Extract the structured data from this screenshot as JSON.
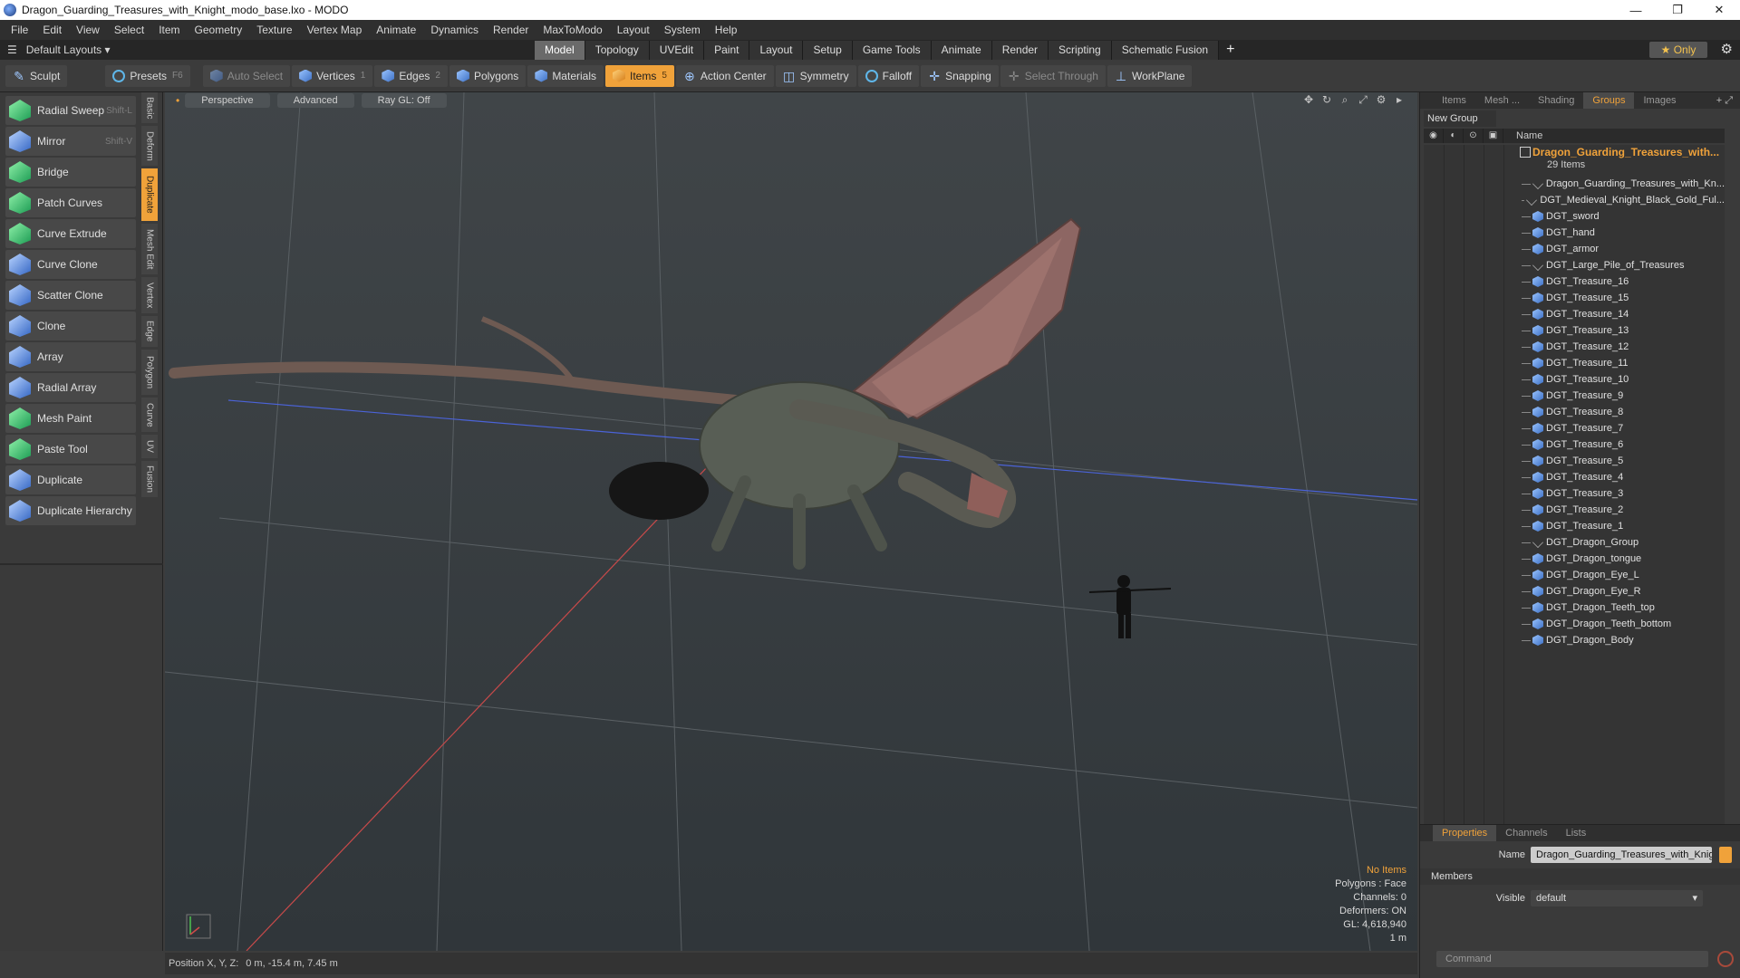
{
  "window": {
    "title": "Dragon_Guarding_Treasures_with_Knight_modo_base.lxo - MODO",
    "controls": [
      "—",
      "❐",
      "✕"
    ]
  },
  "menu": [
    "File",
    "Edit",
    "View",
    "Select",
    "Item",
    "Geometry",
    "Texture",
    "Vertex Map",
    "Animate",
    "Dynamics",
    "Render",
    "MaxToModo",
    "Layout",
    "System",
    "Help"
  ],
  "layouts": {
    "label": "Default Layouts ▾",
    "tabs": [
      "Model",
      "Topology",
      "UVEdit",
      "Paint",
      "Layout",
      "Setup",
      "Game Tools",
      "Animate",
      "Render",
      "Scripting",
      "Schematic Fusion"
    ],
    "active_tab": "Model",
    "only_label": "★  Only"
  },
  "toolbar": {
    "sculpt": "Sculpt",
    "presets": "Presets",
    "presets_key": "F6",
    "auto_select": "Auto Select",
    "vertices": "Vertices",
    "vertices_key": "1",
    "edges": "Edges",
    "edges_key": "2",
    "polygons": "Polygons",
    "materials": "Materials",
    "items": "Items",
    "items_key": "5",
    "action_center": "Action Center",
    "symmetry": "Symmetry",
    "falloff": "Falloff",
    "snapping": "Snapping",
    "select_through": "Select Through",
    "workplane": "WorkPlane"
  },
  "tools": [
    {
      "label": "Radial Sweep",
      "key": "Shift-L",
      "color": "green"
    },
    {
      "label": "Mirror",
      "key": "Shift-V",
      "color": "blue"
    },
    {
      "label": "Bridge",
      "key": "",
      "color": "green"
    },
    {
      "label": "Patch Curves",
      "key": "",
      "color": "green"
    },
    {
      "label": "Curve Extrude",
      "key": "",
      "color": "green"
    },
    {
      "label": "Curve Clone",
      "key": "",
      "color": "blue"
    },
    {
      "label": "Scatter Clone",
      "key": "",
      "color": "blue"
    },
    {
      "label": "Clone",
      "key": "",
      "color": "blue"
    },
    {
      "label": "Array",
      "key": "",
      "color": "blue"
    },
    {
      "label": "Radial Array",
      "key": "",
      "color": "blue"
    },
    {
      "label": "Mesh Paint",
      "key": "",
      "color": "green"
    },
    {
      "label": "Paste Tool",
      "key": "",
      "color": "green"
    },
    {
      "label": "Duplicate",
      "key": "",
      "color": "blue"
    },
    {
      "label": "Duplicate Hierarchy",
      "key": "",
      "color": "blue"
    }
  ],
  "side_tabs": [
    "Basic",
    "Deform",
    "Duplicate",
    "Mesh Edit",
    "Vertex",
    "Edge",
    "Polygon",
    "Curve",
    "UV",
    "Fusion"
  ],
  "side_tab_active": "Duplicate",
  "viewport": {
    "perspective": "Perspective",
    "advanced": "Advanced",
    "raygl": "Ray GL: Off",
    "info": {
      "no_items": "No Items",
      "polygons": "Polygons : Face",
      "channels": "Channels: 0",
      "deformers": "Deformers: ON",
      "gl": "GL: 4,618,940",
      "scale": "1 m"
    }
  },
  "status": {
    "position_label": "Position X, Y, Z:",
    "position_value": "0 m, -15.4 m, 7.45 m"
  },
  "right_panel": {
    "tabs": [
      "Items",
      "Mesh ...",
      "Shading",
      "Groups",
      "Images"
    ],
    "active_tab": "Groups",
    "new_group": "New Group",
    "name_header": "Name",
    "group_name": "Dragon_Guarding_Treasures_with...",
    "group_count": "29 Items",
    "items": [
      "Dragon_Guarding_Treasures_with_Kn...",
      "DGT_Medieval_Knight_Black_Gold_Ful...",
      "DGT_sword",
      "DGT_hand",
      "DGT_armor",
      "DGT_Large_Pile_of_Treasures",
      "DGT_Treasure_16",
      "DGT_Treasure_15",
      "DGT_Treasure_14",
      "DGT_Treasure_13",
      "DGT_Treasure_12",
      "DGT_Treasure_11",
      "DGT_Treasure_10",
      "DGT_Treasure_9",
      "DGT_Treasure_8",
      "DGT_Treasure_7",
      "DGT_Treasure_6",
      "DGT_Treasure_5",
      "DGT_Treasure_4",
      "DGT_Treasure_3",
      "DGT_Treasure_2",
      "DGT_Treasure_1",
      "DGT_Dragon_Group",
      "DGT_Dragon_tongue",
      "DGT_Dragon_Eye_L",
      "DGT_Dragon_Eye_R",
      "DGT_Dragon_Teeth_top",
      "DGT_Dragon_Teeth_bottom",
      "DGT_Dragon_Body"
    ],
    "locator_items": [
      0,
      1,
      5,
      22
    ]
  },
  "properties": {
    "tabs": [
      "Properties",
      "Channels",
      "Lists"
    ],
    "active_tab": "Properties",
    "name_label": "Name",
    "name_value": "Dragon_Guarding_Treasures_with_Knig",
    "members": "Members",
    "visible_label": "Visible",
    "visible_value": "default",
    "command_placeholder": "Command"
  },
  "colors": {
    "accent": "#f0a23a",
    "dragon_body": "#6e5a52",
    "dragon_wing": "#9a6e6a"
  }
}
